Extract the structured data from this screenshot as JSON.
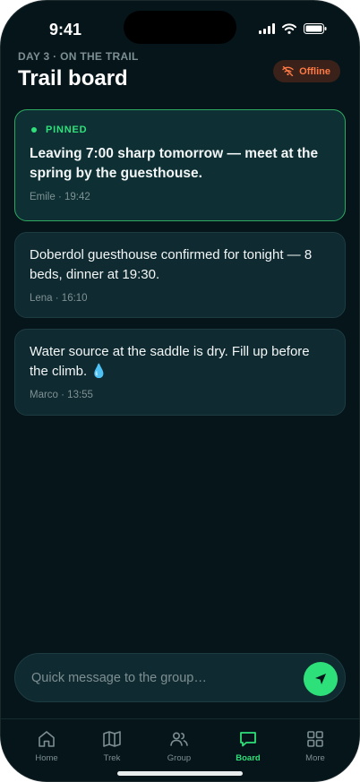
{
  "status": {
    "time": "9:41"
  },
  "header": {
    "eyebrow": "DAY 3 · ON THE TRAIL",
    "title": "Trail board",
    "offline_label": "Offline"
  },
  "messages": [
    {
      "pinned": true,
      "pin_label": "PINNED",
      "text": "Leaving 7:00 sharp tomorrow — meet at the spring by the guesthouse.",
      "author": "Emile",
      "time": "19:42",
      "meta": "Emile · 19:42"
    },
    {
      "pinned": false,
      "text": "Doberdol guesthouse confirmed for tonight — 8 beds, dinner at 19:30.",
      "author": "Lena",
      "time": "16:10",
      "meta": "Lena · 16:10"
    },
    {
      "pinned": false,
      "text": "Water source at the saddle is dry. Fill up before the climb. 💧",
      "author": "Marco",
      "time": "13:55",
      "meta": "Marco · 13:55"
    }
  ],
  "composer": {
    "placeholder": "Quick message to the group…"
  },
  "tabs": [
    {
      "label": "Home",
      "icon": "home-icon",
      "active": false
    },
    {
      "label": "Trek",
      "icon": "map-icon",
      "active": false
    },
    {
      "label": "Group",
      "icon": "group-icon",
      "active": false
    },
    {
      "label": "Board",
      "icon": "chat-icon",
      "active": true
    },
    {
      "label": "More",
      "icon": "grid-icon",
      "active": false
    }
  ],
  "colors": {
    "accent": "#2ee07a",
    "offline": "#ff7a45",
    "background": "#06151a",
    "card": "#0f2a30"
  }
}
